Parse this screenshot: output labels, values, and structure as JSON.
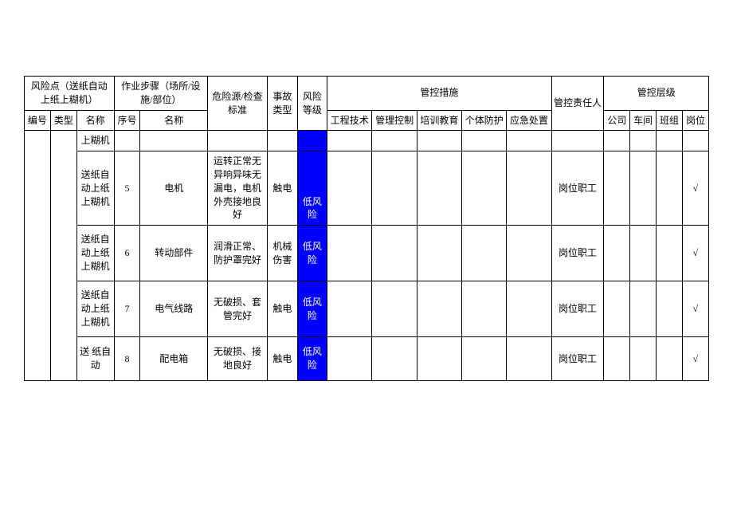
{
  "headers": {
    "risk_point": "风险点（送纸自动上纸上糊机）",
    "work_step": "作业步骤（场所/设施/部位）",
    "hazard_std": "危险源/检查标准",
    "accident_type": "事故类型",
    "risk_level": "风险等级",
    "control_measures": "管控措施",
    "control_owner": "管控责任人",
    "control_level": "管控层级",
    "no": "编号",
    "type": "类型",
    "name": "名称",
    "seq": "序号",
    "stepname": "名称",
    "m_engineering": "工程技术",
    "m_management": "管理控制",
    "m_training": "培训教育",
    "m_ppe": "个体防护",
    "m_emergency": "应急处置",
    "lvl_company": "公司",
    "lvl_workshop": "车间",
    "lvl_team": "班组",
    "lvl_post": "岗位"
  },
  "rows": [
    {
      "name": "上糊机",
      "seq": "",
      "stepname": "",
      "hazard": "",
      "accident": "",
      "level": "",
      "owner": "",
      "post": ""
    },
    {
      "name": "送纸自动上纸上糊机",
      "seq": "5",
      "stepname": "电机",
      "hazard": "运转正常无异响异味无漏电，电机外壳接地良好",
      "accident": "触电",
      "level": "低风险",
      "owner": "岗位职工",
      "post": "√"
    },
    {
      "name": "送纸自动上纸上糊机",
      "seq": "6",
      "stepname": "转动部件",
      "hazard": "润滑正常、防护罩完好",
      "accident": "机械伤害",
      "level": "低风险",
      "owner": "岗位职工",
      "post": "√"
    },
    {
      "name": "送纸自动上纸上糊机",
      "seq": "7",
      "stepname": "电气线路",
      "hazard": "无破损、套管完好",
      "accident": "触电",
      "level": "低风险",
      "owner": "岗位职工",
      "post": "√"
    },
    {
      "name": "送 纸自动",
      "seq": "8",
      "stepname": "配电箱",
      "hazard": "无破损、接地良好",
      "accident": "触电",
      "level": "低风险",
      "owner": "岗位职工",
      "post": "√"
    }
  ]
}
